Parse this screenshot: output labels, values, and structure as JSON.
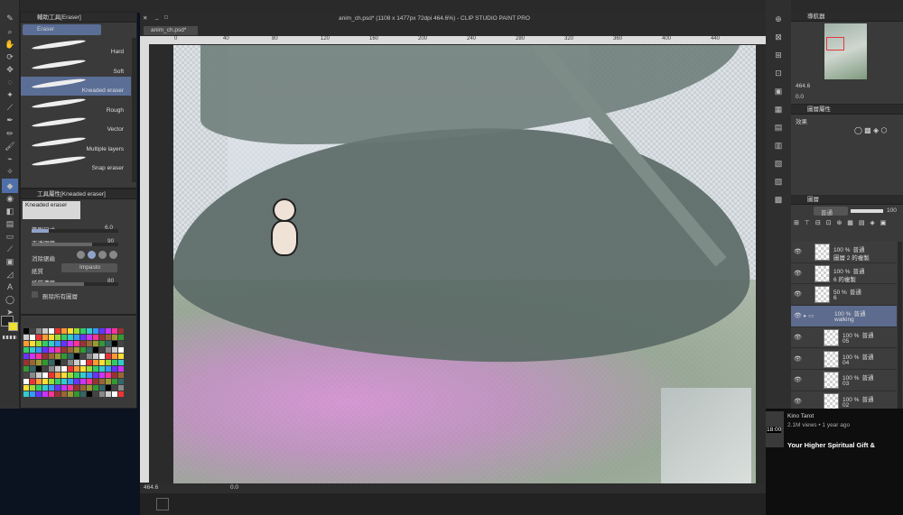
{
  "window": {
    "title": "anim_ch.psd* (1108 x 1477px 72dpi 464.6%) - CLIP STUDIO PAINT PRO",
    "tab": "anim_ch.psd*",
    "zoom": "464.6",
    "angle": "0.0"
  },
  "ruler": {
    "labels": [
      "0",
      "40",
      "80",
      "120",
      "160",
      "200",
      "240",
      "280",
      "320",
      "360",
      "400",
      "440"
    ]
  },
  "subtool": {
    "title": "輔助工具[Eraser]",
    "group": "Eraser",
    "items": [
      "Hard",
      "Soft",
      "Kneaded eraser",
      "Rough",
      "Vector",
      "Multiple layers",
      "Snap eraser"
    ],
    "selected_index": 2
  },
  "toolprop": {
    "title": "工具屬性[Kneaded eraser]",
    "name": "Kneaded eraser",
    "brush_size_label": "筆刷尺寸",
    "brush_size": "6.0",
    "opacity_label": "不透明度",
    "opacity": "90",
    "tip_label": "消除鋸齒",
    "paper_label": "紙質",
    "paper_value": "Impasto",
    "paper_density_label": "紙質濃度",
    "paper_density": "80",
    "erase_all_label": "刪除所有圖層"
  },
  "navigator": {
    "title": "導航器",
    "zoom": "464.6",
    "angle": "0.0"
  },
  "layer_property": {
    "title": "圖層屬性",
    "effect_label": "效果"
  },
  "layers": {
    "title": "圖層",
    "blend": "普通",
    "opacity": "100",
    "items": [
      {
        "pct": "100 %",
        "mode": "普通",
        "name": "圖層 2 的複製"
      },
      {
        "pct": "100 %",
        "mode": "普通",
        "name": "6 的複製"
      },
      {
        "pct": "50 %",
        "mode": "普通",
        "name": "6"
      },
      {
        "pct": "100 %",
        "mode": "普通",
        "name": "walking",
        "folder": true
      },
      {
        "pct": "100 %",
        "mode": "普通",
        "name": "05"
      },
      {
        "pct": "100 %",
        "mode": "普通",
        "name": "04"
      },
      {
        "pct": "100 %",
        "mode": "普通",
        "name": "03"
      },
      {
        "pct": "100 %",
        "mode": "普通",
        "name": "02"
      }
    ]
  },
  "video": {
    "channel": "Kino Tarot",
    "views": "2.1M views • 1 year ago",
    "duration": "18:00",
    "title": "Your Higher Spiritual Gift &"
  },
  "colors": {
    "accent": "#3b6fd1",
    "selected": "#5a6e96",
    "folder_row": "#5c6b8e"
  }
}
